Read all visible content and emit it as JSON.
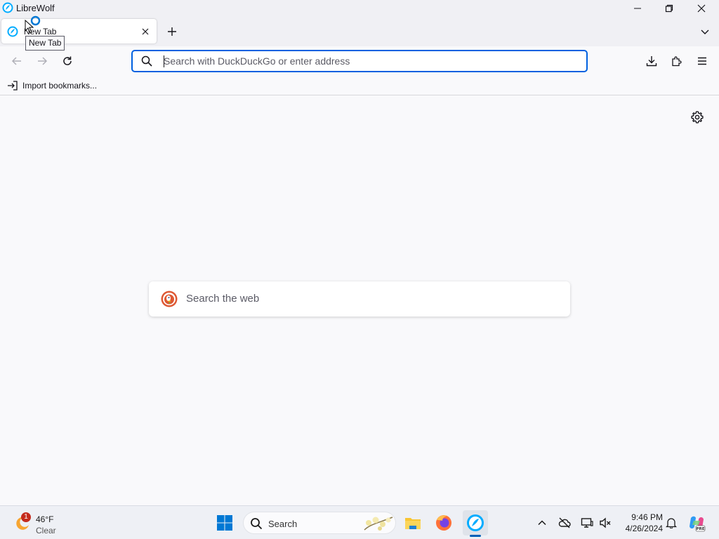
{
  "window": {
    "title": "LibreWolf",
    "controls": [
      "minimize",
      "maximize",
      "close"
    ]
  },
  "tabs": [
    {
      "label": "New Tab",
      "active": true,
      "close_icon": "close-icon"
    }
  ],
  "tooltip": {
    "text": "New Tab"
  },
  "toolbar": {
    "back_icon": "arrow-left-icon",
    "forward_icon": "arrow-right-icon",
    "reload_icon": "reload-icon",
    "urlbar": {
      "value": "",
      "placeholder": "Search with DuckDuckGo or enter address"
    },
    "downloads_icon": "download-icon",
    "extensions_icon": "puzzle-icon",
    "menu_icon": "hamburger-icon"
  },
  "bookmarks": {
    "items": [
      {
        "label": "Import bookmarks...",
        "icon": "import-icon"
      }
    ]
  },
  "content": {
    "settings_icon": "gear-icon",
    "web_search": {
      "placeholder": "Search the web",
      "logo": "duckduckgo-logo"
    }
  },
  "taskbar": {
    "weather": {
      "temperature": "46°F",
      "condition": "Clear",
      "badge": "1"
    },
    "search_label": "Search",
    "apps": [
      "windows-start",
      "search",
      "file-explorer",
      "firefox",
      "librewolf"
    ],
    "clock": {
      "time": "9:46 PM",
      "date": "4/26/2024"
    }
  },
  "colors": {
    "accent": "#0061e0",
    "chrome_bg": "#f0f0f4",
    "page_bg": "#f9f9fb",
    "taskbar_bg": "#eef0f5"
  }
}
